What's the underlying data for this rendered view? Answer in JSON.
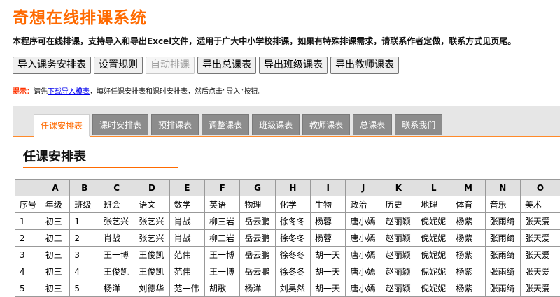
{
  "app": {
    "title": "奇想在线排课系统"
  },
  "intro": "本程序可在线排课，支持导入和导出Excel文件，适用于广大中小学校排课，如果有特殊排课需求，请联系作者定做，联系方式见页尾。",
  "toolbar": {
    "import_label": "导入课务安排表",
    "rules_label": "设置规则",
    "auto_label": "自动排课",
    "export_total_label": "导出总课表",
    "export_class_label": "导出班级课表",
    "export_teacher_label": "导出教师课表"
  },
  "hint": {
    "label": "提示：",
    "pre": "请先",
    "link": "下载导入模表",
    "post": "，填好任课安排表和课时安排表，然后点击“导入”按钮。"
  },
  "tabs": [
    {
      "label": "任课安排表",
      "active": true
    },
    {
      "label": "课时安排表"
    },
    {
      "label": "预排课表"
    },
    {
      "label": "调整课表"
    },
    {
      "label": "班级课表"
    },
    {
      "label": "教师课表"
    },
    {
      "label": "总课表"
    },
    {
      "label": "联系我们"
    }
  ],
  "section": {
    "title": "任课安排表"
  },
  "table": {
    "letters": [
      "A",
      "B",
      "C",
      "D",
      "E",
      "F",
      "G",
      "H",
      "I",
      "J",
      "K",
      "L",
      "M",
      "N",
      "O"
    ],
    "headers": [
      "序号",
      "年级",
      "班级",
      "班会",
      "语文",
      "数学",
      "英语",
      "物理",
      "化学",
      "生物",
      "政治",
      "历史",
      "地理",
      "体育",
      "音乐",
      "美术"
    ],
    "rows": [
      [
        "1",
        "初三",
        "1",
        "张艺兴",
        "张艺兴",
        "肖战",
        "柳三岩",
        "岳云鹏",
        "徐冬冬",
        "杨蓉",
        "唐小嫣",
        "赵丽颖",
        "倪妮妮",
        "杨紫",
        "张雨绮",
        "张天爱"
      ],
      [
        "2",
        "初三",
        "2",
        "肖战",
        "张艺兴",
        "肖战",
        "柳三岩",
        "岳云鹏",
        "徐冬冬",
        "杨蓉",
        "唐小嫣",
        "赵丽颖",
        "倪妮妮",
        "杨紫",
        "张雨绮",
        "张天爱"
      ],
      [
        "3",
        "初三",
        "3",
        "王一博",
        "王俊凯",
        "范伟",
        "王一博",
        "岳云鹏",
        "徐冬冬",
        "胡一天",
        "唐小嫣",
        "赵丽颖",
        "倪妮妮",
        "杨紫",
        "张雨绮",
        "张天爱"
      ],
      [
        "4",
        "初三",
        "4",
        "王俊凯",
        "王俊凯",
        "范伟",
        "王一博",
        "岳云鹏",
        "徐冬冬",
        "胡一天",
        "唐小嫣",
        "赵丽颖",
        "倪妮妮",
        "杨紫",
        "张雨绮",
        "张天爱"
      ],
      [
        "5",
        "初三",
        "5",
        "杨洋",
        "刘德华",
        "范一伟",
        "胡歌",
        "杨洋",
        "刘昊然",
        "胡一天",
        "唐小嫣",
        "赵丽颖",
        "倪妮妮",
        "杨紫",
        "张雨绮",
        "张天爱"
      ]
    ]
  },
  "colors": {
    "accent": "#ff6a00",
    "tab_inactive": "#8c8c8c",
    "tabbar_bg": "#e6e6e6"
  }
}
